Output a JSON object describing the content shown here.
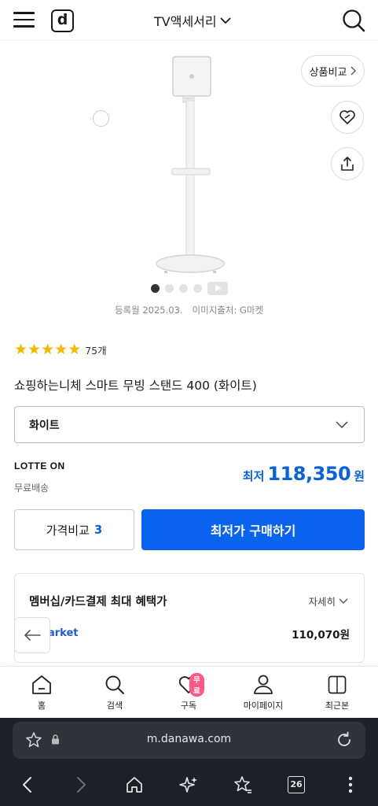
{
  "header": {
    "logo_letter": "d",
    "category": "TV액세서리"
  },
  "gallery": {
    "compare_label": "상품비교",
    "registered": "등록월 2025.03.",
    "image_source": "이미지출처: G마켓"
  },
  "product": {
    "rating_count": "75개",
    "rating_stars": 5,
    "name": "쇼핑하는니체 스마트 무빙 스탠드 400 (화이트)",
    "option_value": "화이트"
  },
  "offer": {
    "store_logo": "LOTTE ON",
    "shipping": "무료배송",
    "price_label": "최저",
    "price_value": "118,350",
    "price_unit": "원"
  },
  "actions": {
    "compare_label": "가격비교",
    "compare_count": "3",
    "buy_label": "최저가 구매하기"
  },
  "benefit": {
    "title": "멤버십/카드결제 최대 혜택가",
    "more_label": "자세히",
    "store_name": "arket",
    "price": "110,070원"
  },
  "bottom_nav": {
    "items": [
      {
        "label": "홈",
        "icon": "home-icon"
      },
      {
        "label": "검색",
        "icon": "search-icon"
      },
      {
        "label": "구독",
        "icon": "heart-icon",
        "badge": "무료"
      },
      {
        "label": "마이페이지",
        "icon": "user-icon"
      },
      {
        "label": "최근본",
        "icon": "recent-icon"
      }
    ]
  },
  "browser": {
    "url": "m.danawa.com",
    "tab_count": "26"
  },
  "colors": {
    "accent": "#0a63ec",
    "price": "#0a63d6",
    "star": "#f5b800",
    "badge": "#ff5a86"
  }
}
